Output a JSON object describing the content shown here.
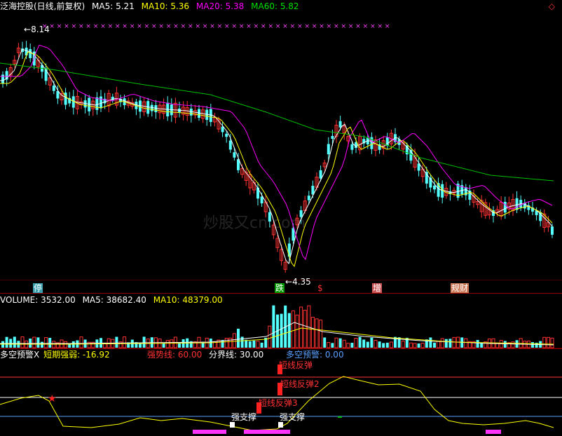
{
  "header": {
    "title": "泛海控股(日线,前复权)",
    "ma5": "MA5: 5.21",
    "ma10": "MA10: 5.36",
    "ma20": "MA20: 5.38",
    "ma60": "MA60: 5.82",
    "expand_arrow": "◇"
  },
  "price_panel": {
    "high_label": "8.14",
    "low_label": "4.35",
    "markers": [
      "停",
      "跌",
      "$",
      "增",
      "规财"
    ],
    "top_symbols": "× × × × ×   × × ×     × × × × ×   × × × ×   × ×   × × × × ×   × × ×     × × × × ×   ×   × ×   × × × × × × × ×   × ×     ×           ×           ×",
    "watermark": "炒股又cn.com"
  },
  "volume_panel": {
    "volume": "VOLUME: 3532.00",
    "ma5": "MA5: 38682.40",
    "ma10": "MA10: 48379.00"
  },
  "indicator_panel": {
    "name": "多空预警X",
    "short_label": "短期强弱: -16.92",
    "strong_line": "强势线: 60.00",
    "divider_line": "分界线: 30.00",
    "warning": "多空预警: 0.00",
    "signals": [
      "短线反弹",
      "短线反弹2",
      "短线反弹3",
      "强支撑",
      "强支撑"
    ]
  },
  "colors": {
    "up": "#ff3232",
    "down": "#54ffff",
    "ma5": "#ffffff",
    "ma10": "#ffff00",
    "ma20": "#ff00ff",
    "ma60": "#00c000",
    "frame": "#8b0000"
  }
}
